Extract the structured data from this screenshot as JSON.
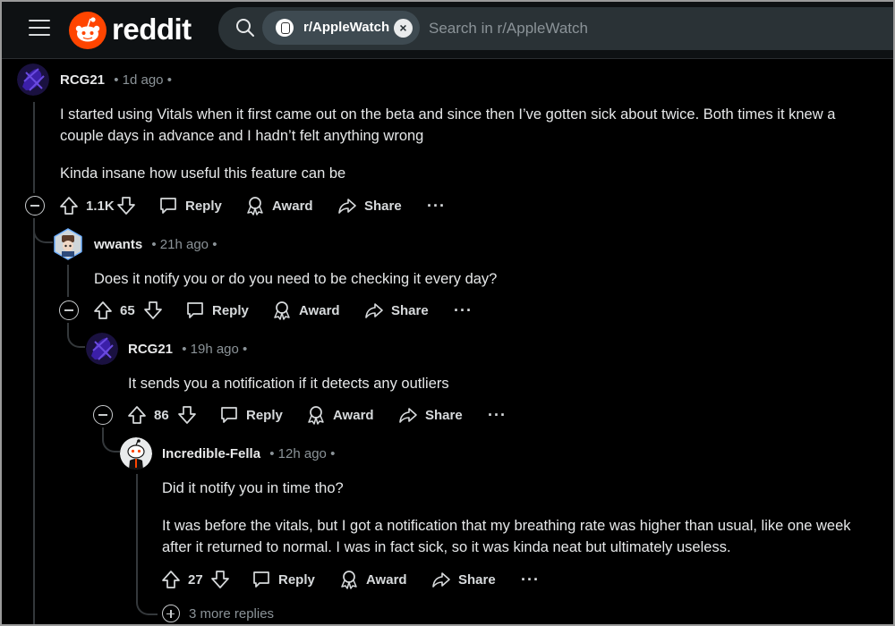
{
  "header": {
    "brand": "reddit",
    "search_chip": "r/AppleWatch",
    "search_placeholder": "Search in r/AppleWatch"
  },
  "icons": {
    "menu": "hamburger-icon",
    "search": "search-icon",
    "upvote": "arrow-up-icon",
    "downvote": "arrow-down-icon",
    "reply": "speech-bubble-icon",
    "award": "award-ribbon-icon",
    "share": "share-arrow-icon",
    "more": "ellipsis-icon"
  },
  "comments": [
    {
      "user": "RCG21",
      "time": "1d ago",
      "sep": "•",
      "paragraphs": [
        "I started using Vitals when it first came out on the beta and since then I’ve gotten sick about twice. Both times it knew a couple days in advance and I hadn’t felt anything wrong",
        "Kinda insane how useful this feature can be"
      ],
      "score": "1.1K"
    },
    {
      "user": "wwants",
      "time": "21h ago",
      "sep": "•",
      "paragraphs": [
        "Does it notify you or do you need to be checking it every day?"
      ],
      "score": "65"
    },
    {
      "user": "RCG21",
      "time": "19h ago",
      "sep": "•",
      "paragraphs": [
        "It sends you a notification if it detects any outliers"
      ],
      "score": "86"
    },
    {
      "user": "Incredible-Fella",
      "time": "12h ago",
      "sep": "•",
      "paragraphs": [
        "Did it notify you in time tho?",
        "It was before the vitals, but I got a notification that my breathing rate was higher than usual, like one week after it returned to normal. I was in fact sick, so it was kinda neat but ultimately useless."
      ],
      "score": "27"
    }
  ],
  "action_labels": {
    "reply": "Reply",
    "award": "Award",
    "share": "Share",
    "more": "···"
  },
  "more_replies": "3 more replies",
  "colors": {
    "brand": "#ff4500",
    "background": "#000000",
    "search_bg": "#2a3236"
  }
}
